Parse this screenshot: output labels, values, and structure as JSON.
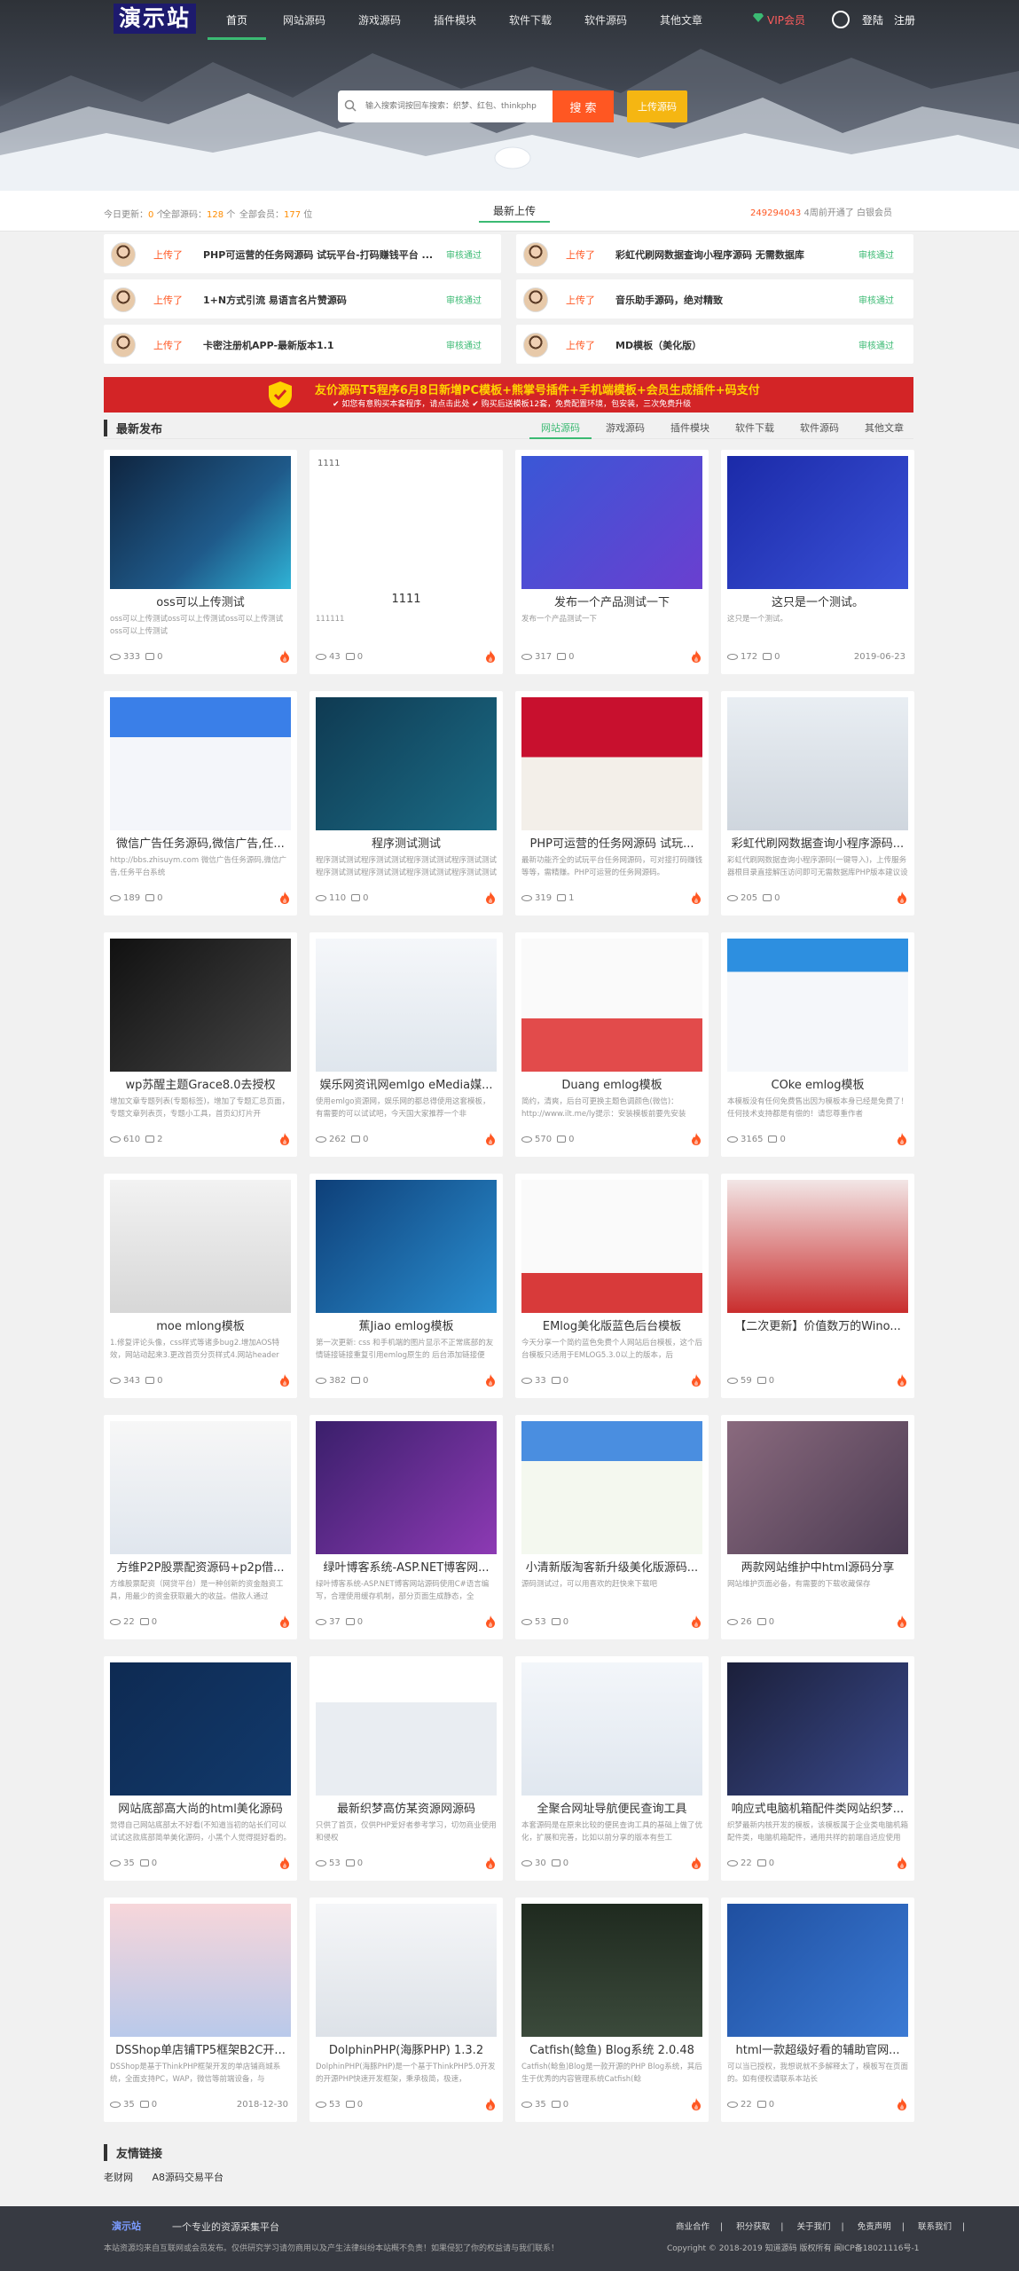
{
  "header": {
    "logo": "演示站",
    "nav": [
      "首页",
      "网站源码",
      "游戏源码",
      "插件模块",
      "软件下载",
      "软件源码",
      "其他文章"
    ],
    "vip": "VIP会员",
    "login": "登陆",
    "register": "注册",
    "search_placeholder": "输入搜索词按回车搜索：织梦、红包、thinkphp",
    "search_button": "搜 索",
    "upload_button": "上传源码"
  },
  "stats": {
    "today_label": "今日更新：",
    "today_value": "0",
    "today_unit": "个",
    "all_label": "全部源码：",
    "all_value": "128",
    "all_unit": "个",
    "total_label": "全部会员：",
    "total_value": "177",
    "total_unit": "位",
    "tab": "最新上传",
    "user": "249294043",
    "user_tip": "4周前开通了 白银会员"
  },
  "uploads": [
    {
      "tag": "上传了",
      "title": "PHP可运营的任务网源码 试玩平台-打码赚钱平台 ...",
      "status": "审核通过"
    },
    {
      "tag": "上传了",
      "title": "彩虹代刷网数据查询小程序源码 无需数据库",
      "status": "审核通过"
    },
    {
      "tag": "上传了",
      "title": "1+N方式引流 易语言名片赞源码",
      "status": "审核通过"
    },
    {
      "tag": "上传了",
      "title": "音乐助手源码，绝对精致",
      "status": "审核通过"
    },
    {
      "tag": "上传了",
      "title": "卡密注册机APP-最新版本1.1",
      "status": "审核通过"
    },
    {
      "tag": "上传了",
      "title": "MD模板（美化版）",
      "status": "审核通过"
    }
  ],
  "banner": {
    "line1": "友价源码T5程序6月8日新增PC模板+熊掌号插件+手机端模板+会员生成插件+码支付",
    "line2": "✔ 如您有意购买本套程序，请点击此处    ✔ 购买后送模板12套，免费配置环境，包安装，三次免费升级"
  },
  "section": {
    "title": "最新发布",
    "tabs": [
      "网站源码",
      "游戏源码",
      "插件模块",
      "软件下载",
      "软件源码",
      "其他文章"
    ]
  },
  "cards": [
    {
      "title": "oss可以上传测试",
      "desc": "oss可以上传测试oss可以上传测试oss可以上传测试oss可以上传测试",
      "views": "333",
      "comments": "0",
      "date": ""
    },
    {
      "title": "1111",
      "desc": "111111",
      "views": "43",
      "comments": "0",
      "date": "",
      "alt": "1111"
    },
    {
      "title": "发布一个产品测试一下",
      "desc": "发布一个产品测试一下",
      "views": "317",
      "comments": "0",
      "date": ""
    },
    {
      "title": "这只是一个测试。",
      "desc": "这只是一个测试。",
      "views": "172",
      "comments": "0",
      "date": "2019-06-23"
    },
    {
      "title": "微信广告任务源码,微信广告,任...",
      "desc": "http://bbs.zhisuym.com 微信广告任务源码,微信广告,任务平台系统",
      "views": "189",
      "comments": "0",
      "date": ""
    },
    {
      "title": "程序测试测试",
      "desc": "程序测试测试程序测试测试程序测试测试程序测试测试程序测试测试程序测试测试程序测试测试程序测试测试",
      "views": "110",
      "comments": "0",
      "date": ""
    },
    {
      "title": "PHP可运营的任务网源码 试玩...",
      "desc": "最新功能齐全的试玩平台任务网源码，可对接打码赚钱等等，需精赚。PHP可运营的任务网源码。",
      "views": "319",
      "comments": "1",
      "date": ""
    },
    {
      "title": "彩虹代刷网数据查询小程序源码...",
      "desc": "彩虹代刷网数据查询小程序源码(一键导入)，上传服务器根目录直接解压访问即可无需数据库PHP版本建议设置",
      "views": "205",
      "comments": "0",
      "date": ""
    },
    {
      "title": "wp苏醒主题Grace8.0去授权",
      "desc": "增加文章专题列表(专题标签)，增加了专题汇总页面，专题文章列表页，专题小工具，首页幻灯片开",
      "views": "610",
      "comments": "2",
      "date": ""
    },
    {
      "title": "娱乐网资讯网emlgo eMedia媒...",
      "desc": "使用emlgo资源网，娱乐网的都总得使用这套模板，有需要的可以试试吧，今天国大家推荐一个非",
      "views": "262",
      "comments": "0",
      "date": ""
    },
    {
      "title": "Duang emlog模板",
      "desc": "简约，清爽，后台可更换主题色调颜色(微信)：http://www.ilt.me/ly提示：安装模板前要先安装",
      "views": "570",
      "comments": "0",
      "date": ""
    },
    {
      "title": "COke emlog模板",
      "desc": "本模板没有任何免费售出因为模板本身已经是免费了！任何技术支持都是有偿的！请您尊重作者",
      "views": "3165",
      "comments": "0",
      "date": ""
    },
    {
      "title": "moe mlong模板",
      "desc": "1.修复评论头像，css样式等诸多bug2.增加AOS特效，网站动起来3.更改首页分页样式4.网站header",
      "views": "343",
      "comments": "0",
      "date": ""
    },
    {
      "title": "蕉Jiao emlog模板",
      "desc": "第一次更新: css 和手机端的图片显示不正常底部的友情链接链接重复引用emlog原生的 后台添加链接便",
      "views": "382",
      "comments": "0",
      "date": ""
    },
    {
      "title": "EMlog美化版蓝色后台模板",
      "desc": "今天分享一个简约蓝色免费个人网站后台模板，这个后台模板只适用于EMLOG5.3.0以上的版本，后",
      "views": "33",
      "comments": "0",
      "date": ""
    },
    {
      "title": "【二次更新】价值数万的Wino...",
      "desc": "",
      "views": "59",
      "comments": "0",
      "date": ""
    },
    {
      "title": "方维P2P股票配资源码+p2p借...",
      "desc": "方维股票配资（网贷平台）是一种创新的资金融资工具，用最少的资金获取最大的收益。借款人通过",
      "views": "22",
      "comments": "0",
      "date": ""
    },
    {
      "title": "绿叶博客系统-ASP.NET博客网...",
      "desc": "绿叶博客系统-ASP.NET博客网站源码使用C#语言编写，合理使用缓存机制，部分页面生成静态，全",
      "views": "37",
      "comments": "0",
      "date": ""
    },
    {
      "title": "小清新版淘客新升级美化版源码...",
      "desc": "源码测试过，可以用喜欢的赶快来下载吧",
      "views": "53",
      "comments": "0",
      "date": ""
    },
    {
      "title": "两款网站维护中html源码分享",
      "desc": "网站维护页面必备，有需要的下载收藏保存",
      "views": "26",
      "comments": "0",
      "date": ""
    },
    {
      "title": "网站底部高大尚的html美化源码",
      "desc": "觉得自己网站底部太不好看(不知道当初的站长们可以试试这款底部简单美化源码，小黑个人觉得挺好看的。",
      "views": "35",
      "comments": "0",
      "date": ""
    },
    {
      "title": "最新织梦高仿某资源网源码",
      "desc": "只供了首页，仅供PHP爱好者参考学习，切勿商业使用和侵权",
      "views": "53",
      "comments": "0",
      "date": ""
    },
    {
      "title": "全聚合网址导航便民查询工具",
      "desc": "本套源码是在原来比较的便民查询工具的基础上做了优化，扩展和完善，比如以前分享的版本有些工",
      "views": "30",
      "comments": "0",
      "date": ""
    },
    {
      "title": "响应式电脑机箱配件类网站织梦...",
      "desc": "织梦最新内核开发的模板，该模板属于企业类电脑机箱配件类，电脑机箱配件，通用共样的前端自适应使用",
      "views": "22",
      "comments": "0",
      "date": ""
    },
    {
      "title": "DSShop单店铺TP5框架B2C开...",
      "desc": "DSShop是基于ThinkPHP框架开发的单店铺商城系统，全面支持PC，WAP，微信等前端设备，与",
      "views": "35",
      "comments": "0",
      "date": "2018-12-30"
    },
    {
      "title": "DolphinPHP(海豚PHP) 1.3.2",
      "desc": "DolphinPHP(海豚PHP)是一个基于ThinkPHP5.0开发的开源PHP快速开发框架，秉承极简，极速，",
      "views": "53",
      "comments": "0",
      "date": ""
    },
    {
      "title": "Catfish(鲶鱼) Blog系统 2.0.48",
      "desc": "Catfish(鲶鱼)Blog是一款开源的PHP Blog系统，其后生于优秀的内容管理系统Catfish(鲶",
      "views": "35",
      "comments": "0",
      "date": ""
    },
    {
      "title": "html一款超级好看的辅助官网...",
      "desc": "可以当已授权，我想说就不多解释太了，模板写在页面的。如有侵权请联系本站长",
      "views": "22",
      "comments": "0",
      "date": ""
    }
  ],
  "links": {
    "title": "友情链接",
    "items": [
      "老财网",
      "A8源码交易平台"
    ]
  },
  "footer": {
    "logo": "演示站",
    "slogan": "一个专业的资源采集平台",
    "note": "本站资源均来自互联网或会员发布。仅供研究学习请勿商用以及产生法律纠纷本站概不负责！如果侵犯了你的权益请与我们联系！",
    "links": [
      "商业合作",
      "|",
      "积分获取",
      "|",
      "关于我们",
      "|",
      "免责声明",
      "|",
      "联系我们",
      "|"
    ],
    "copyright": "Copyright © 2018-2019 知道源码 版权所有 闽ICP备18021116号-1"
  }
}
